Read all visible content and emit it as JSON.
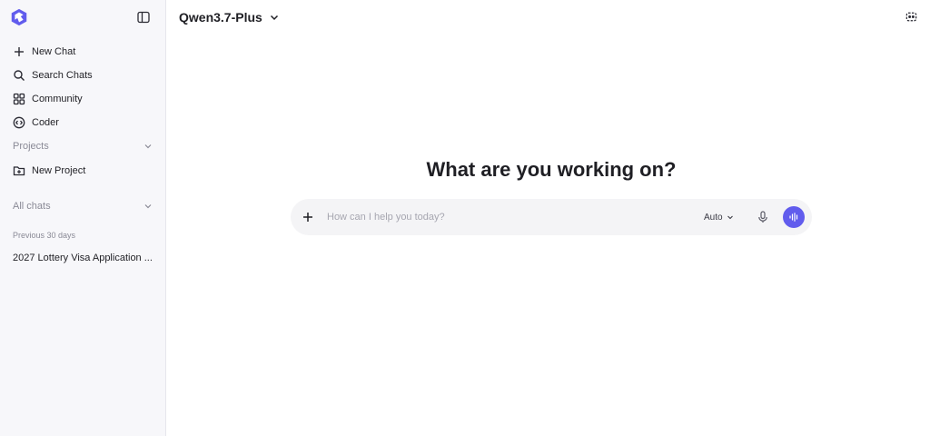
{
  "app": {
    "model_name": "Qwen3.7-Plus",
    "colors": {
      "accent": "#615ced",
      "sidebar_bg": "#f7f7fa",
      "composer_bg": "#f4f4f6"
    }
  },
  "sidebar": {
    "logo_icon": "qwen-logo-icon",
    "toggle_icon": "sidebar-toggle-icon",
    "nav": [
      {
        "label": "New Chat",
        "icon": "plus-icon"
      },
      {
        "label": "Search Chats",
        "icon": "search-icon"
      },
      {
        "label": "Community",
        "icon": "grid-icon"
      },
      {
        "label": "Coder",
        "icon": "code-icon"
      }
    ],
    "projects_header": "Projects",
    "new_project": {
      "label": "New Project",
      "icon": "folder-plus-icon"
    },
    "all_chats_header": "All chats",
    "group_label": "Previous 30 days",
    "chats": [
      {
        "title": "2027 Lottery Visa Application ..."
      }
    ]
  },
  "main": {
    "heading": "What are you working on?",
    "composer": {
      "placeholder": "How can I help you today?",
      "value": "",
      "mode": "Auto"
    }
  }
}
